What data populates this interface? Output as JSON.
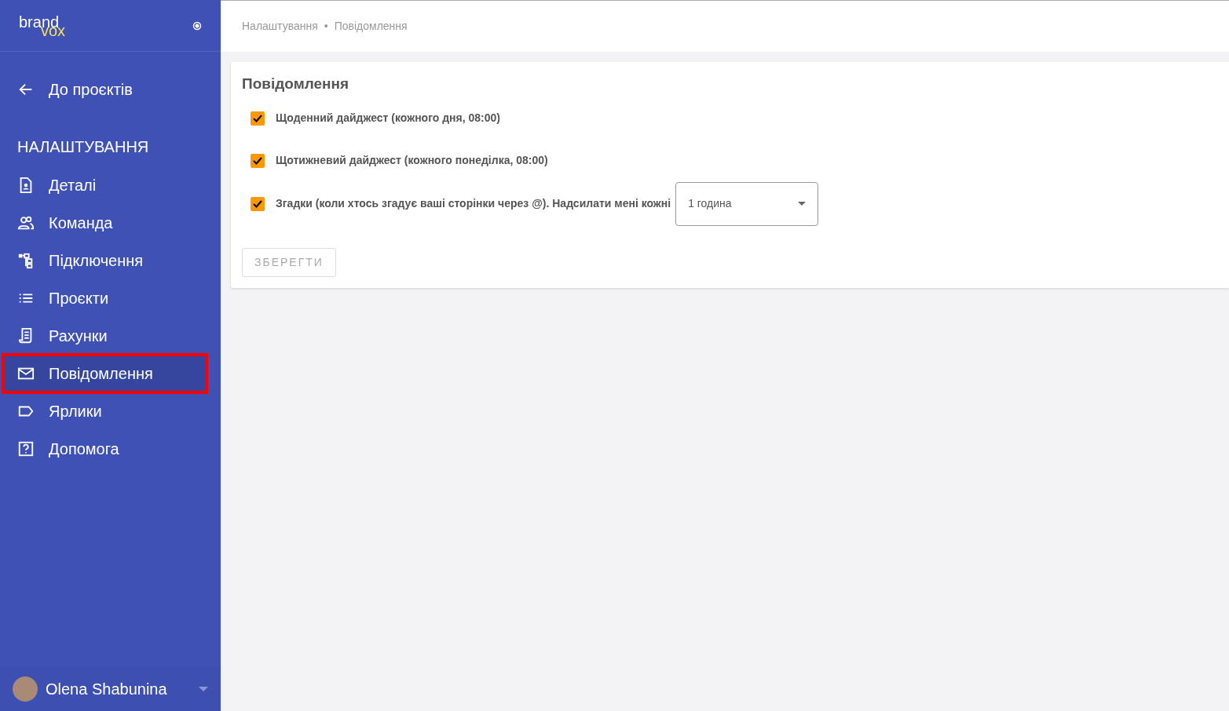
{
  "sidebar": {
    "logo": {
      "part_1": "brand",
      "part_2": "vox"
    },
    "back_link": "До проєктів",
    "section_title": "НАЛАШТУВАННЯ",
    "items": [
      {
        "label": "Деталі",
        "kind": "details",
        "selected": false,
        "highlighted": false
      },
      {
        "label": "Команда",
        "kind": "team",
        "selected": false,
        "highlighted": false
      },
      {
        "label": "Підключення",
        "kind": "connections",
        "selected": false,
        "highlighted": false
      },
      {
        "label": "Проєкти",
        "kind": "projects",
        "selected": false,
        "highlighted": false
      },
      {
        "label": "Рахунки",
        "kind": "invoices",
        "selected": false,
        "highlighted": false
      },
      {
        "label": "Повідомлення",
        "kind": "notifications",
        "selected": true,
        "highlighted": true
      },
      {
        "label": "Ярлики",
        "kind": "labels",
        "selected": false,
        "highlighted": false
      },
      {
        "label": "Допомога",
        "kind": "help",
        "selected": false,
        "highlighted": false
      }
    ],
    "user": {
      "name": "Olena Shabunina"
    }
  },
  "breadcrumb": {
    "items": [
      "Налаштування",
      "Повідомлення"
    ],
    "separator": "•"
  },
  "card": {
    "title": "Повідомлення",
    "options": [
      {
        "label": "Щоденний дайджест (кожного дня, 08:00)",
        "checked": true
      },
      {
        "label": "Щотижневий дайджест (кожного понеділка, 08:00)",
        "checked": true
      },
      {
        "label": "Згадки (коли хтось згадує ваші сторінки через @). Надсилати мені кожні",
        "checked": true,
        "select_value": "1 година"
      }
    ],
    "save_button": {
      "label": "ЗБЕРЕГТИ",
      "disabled": true
    }
  }
}
